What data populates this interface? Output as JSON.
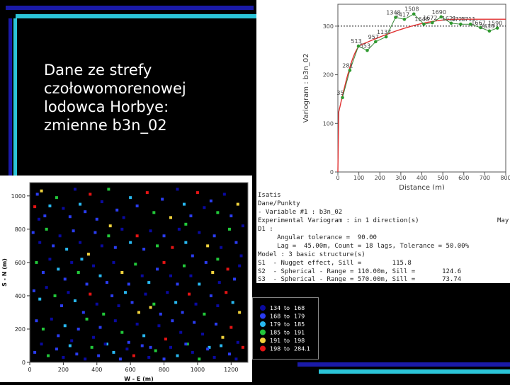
{
  "slide": {
    "title_lines": [
      "Dane ze strefy",
      "czołowomorenowej",
      "lodowca Horbye:",
      "zmienne b3n_02"
    ],
    "colors": {
      "background": "#000000",
      "accent_blue": "#1a1aa8",
      "accent_cyan": "#2bc4d8"
    }
  },
  "info_panel": {
    "lines": [
      "Isatis",
      "Dane/Punkty",
      "- Variable #1 : b3n_02",
      "Experimental Variogram : in 1 direction(s)",
      "D1 :",
      "     Angular tolerance =  90.00",
      "     Lag =  45.00m, Count = 18 lags, Tolerance = 50.00%",
      "Model : 3 basic structure(s)",
      "S1  - Nugget effect, Sill =        115.8",
      "S2  - Spherical - Range = 110.00m, Sill =       124.6",
      "S3  - Spherical - Range = 570.00m, Sill =       73.74"
    ],
    "truncated_right": "May"
  },
  "chart_data": [
    {
      "type": "line",
      "xlabel": "Distance (m)",
      "ylabel": "Variogram : b3n_02",
      "xlim": [
        0,
        800
      ],
      "ylim": [
        0,
        345
      ],
      "xticks": [
        0,
        100,
        200,
        300,
        400,
        500,
        600,
        700,
        800
      ],
      "yticks": [
        0,
        100,
        200,
        300
      ],
      "sill_line": 300,
      "experimental": [
        {
          "x": 22,
          "y": 153,
          "label": "35"
        },
        {
          "x": 57,
          "y": 209,
          "label": "281"
        },
        {
          "x": 98,
          "y": 259,
          "label": "513"
        },
        {
          "x": 140,
          "y": 250,
          "label": "553"
        },
        {
          "x": 180,
          "y": 268,
          "label": "957"
        },
        {
          "x": 230,
          "y": 278,
          "label": "1137"
        },
        {
          "x": 275,
          "y": 318,
          "label": "1348"
        },
        {
          "x": 317,
          "y": 314,
          "label": "1417"
        },
        {
          "x": 362,
          "y": 325,
          "label": "1508"
        },
        {
          "x": 410,
          "y": 304,
          "label": "1646"
        },
        {
          "x": 450,
          "y": 307,
          "label": "1672"
        },
        {
          "x": 492,
          "y": 319,
          "label": "1690"
        },
        {
          "x": 540,
          "y": 306,
          "label": "1621"
        },
        {
          "x": 585,
          "y": 304,
          "label": "1725"
        },
        {
          "x": 632,
          "y": 304,
          "label": "1711"
        },
        {
          "x": 680,
          "y": 297,
          "label": "1667"
        },
        {
          "x": 722,
          "y": 290,
          "label": "1633"
        },
        {
          "x": 760,
          "y": 296,
          "label": "1590"
        }
      ],
      "model": {
        "nugget": 115.8,
        "structures": [
          {
            "type": "spherical",
            "range": 110,
            "sill": 124.6
          },
          {
            "type": "spherical",
            "range": 570,
            "sill": 73.74
          }
        ]
      }
    },
    {
      "type": "scatter",
      "xlabel": "W - E (m)",
      "ylabel": "S - N (m)",
      "xlim": [
        0,
        1300
      ],
      "ylim": [
        0,
        1080
      ],
      "xticks": [
        0,
        200,
        400,
        600,
        800,
        1000,
        1200
      ],
      "yticks": [
        0,
        200,
        400,
        600,
        800,
        1000
      ],
      "legend": [
        {
          "label_from": "134",
          "to": "to",
          "label_to": "168",
          "color": "#0a0aa0"
        },
        {
          "label_from": "168",
          "to": "to",
          "label_to": "179",
          "color": "#2a3cf0"
        },
        {
          "label_from": "179",
          "to": "to",
          "label_to": "185",
          "color": "#28b8f0"
        },
        {
          "label_from": "185",
          "to": "to",
          "label_to": "191",
          "color": "#22c83a"
        },
        {
          "label_from": "191",
          "to": "to",
          "label_to": "198",
          "color": "#f0d23c"
        },
        {
          "label_from": "198",
          "to": "to",
          "label_to": "284.1",
          "color": "#e41414"
        }
      ],
      "points": [
        [
          30,
          935,
          5
        ],
        [
          45,
          1010,
          1
        ],
        [
          55,
          860,
          0
        ],
        [
          70,
          1030,
          4
        ],
        [
          90,
          880,
          1
        ],
        [
          120,
          940,
          2
        ],
        [
          160,
          990,
          3
        ],
        [
          200,
          925,
          0
        ],
        [
          240,
          875,
          1
        ],
        [
          270,
          1040,
          0
        ],
        [
          300,
          950,
          2
        ],
        [
          330,
          905,
          1
        ],
        [
          360,
          1010,
          5
        ],
        [
          400,
          860,
          1
        ],
        [
          430,
          965,
          0
        ],
        [
          470,
          1040,
          3
        ],
        [
          520,
          915,
          1
        ],
        [
          560,
          870,
          0
        ],
        [
          600,
          990,
          2
        ],
        [
          640,
          940,
          1
        ],
        [
          700,
          1020,
          5
        ],
        [
          740,
          900,
          3
        ],
        [
          790,
          980,
          1
        ],
        [
          840,
          870,
          4
        ],
        [
          880,
          1040,
          0
        ],
        [
          920,
          950,
          2
        ],
        [
          960,
          880,
          1
        ],
        [
          1000,
          1020,
          5
        ],
        [
          1040,
          930,
          0
        ],
        [
          1080,
          970,
          1
        ],
        [
          1120,
          900,
          3
        ],
        [
          1160,
          1010,
          0
        ],
        [
          1200,
          880,
          1
        ],
        [
          1240,
          950,
          4
        ],
        [
          1270,
          820,
          0
        ],
        [
          20,
          780,
          1
        ],
        [
          60,
          720,
          0
        ],
        [
          100,
          800,
          3
        ],
        [
          140,
          700,
          1
        ],
        [
          180,
          760,
          0
        ],
        [
          220,
          680,
          2
        ],
        [
          260,
          790,
          1
        ],
        [
          300,
          720,
          0
        ],
        [
          350,
          650,
          4
        ],
        [
          390,
          780,
          1
        ],
        [
          430,
          700,
          0
        ],
        [
          470,
          760,
          3
        ],
        [
          510,
          690,
          1
        ],
        [
          550,
          800,
          0
        ],
        [
          600,
          720,
          2
        ],
        [
          640,
          760,
          5
        ],
        [
          680,
          680,
          1
        ],
        [
          720,
          790,
          0
        ],
        [
          760,
          700,
          3
        ],
        [
          800,
          760,
          1
        ],
        [
          850,
          690,
          5
        ],
        [
          890,
          800,
          0
        ],
        [
          930,
          720,
          2
        ],
        [
          970,
          640,
          1
        ],
        [
          1010,
          780,
          0
        ],
        [
          1060,
          700,
          4
        ],
        [
          1100,
          760,
          1
        ],
        [
          1140,
          690,
          0
        ],
        [
          1190,
          800,
          3
        ],
        [
          1230,
          720,
          1
        ],
        [
          1260,
          640,
          0
        ],
        [
          40,
          600,
          3
        ],
        [
          80,
          540,
          1
        ],
        [
          120,
          620,
          0
        ],
        [
          170,
          560,
          2
        ],
        [
          210,
          500,
          1
        ],
        [
          250,
          600,
          0
        ],
        [
          290,
          540,
          3
        ],
        [
          340,
          470,
          1
        ],
        [
          380,
          580,
          0
        ],
        [
          420,
          520,
          2
        ],
        [
          460,
          480,
          1
        ],
        [
          500,
          600,
          0
        ],
        [
          550,
          540,
          4
        ],
        [
          590,
          470,
          1
        ],
        [
          630,
          590,
          3
        ],
        [
          670,
          520,
          0
        ],
        [
          710,
          480,
          2
        ],
        [
          760,
          560,
          1
        ],
        [
          800,
          600,
          5
        ],
        [
          840,
          520,
          0
        ],
        [
          880,
          470,
          1
        ],
        [
          920,
          580,
          3
        ],
        [
          960,
          520,
          0
        ],
        [
          1010,
          470,
          2
        ],
        [
          1050,
          600,
          1
        ],
        [
          1090,
          540,
          4
        ],
        [
          1130,
          480,
          0
        ],
        [
          1180,
          560,
          5
        ],
        [
          1220,
          500,
          1
        ],
        [
          1250,
          580,
          0
        ],
        [
          25,
          430,
          1
        ],
        [
          60,
          380,
          2
        ],
        [
          100,
          450,
          0
        ],
        [
          150,
          400,
          3
        ],
        [
          190,
          340,
          1
        ],
        [
          230,
          420,
          0
        ],
        [
          270,
          370,
          2
        ],
        [
          320,
          300,
          1
        ],
        [
          360,
          410,
          5
        ],
        [
          400,
          350,
          0
        ],
        [
          440,
          290,
          3
        ],
        [
          490,
          400,
          1
        ],
        [
          530,
          340,
          0
        ],
        [
          570,
          420,
          2
        ],
        [
          610,
          360,
          1
        ],
        [
          650,
          300,
          4
        ],
        [
          690,
          410,
          0
        ],
        [
          740,
          350,
          3
        ],
        [
          780,
          290,
          1
        ],
        [
          820,
          420,
          0
        ],
        [
          870,
          360,
          2
        ],
        [
          910,
          300,
          1
        ],
        [
          950,
          410,
          5
        ],
        [
          990,
          350,
          0
        ],
        [
          1040,
          290,
          3
        ],
        [
          1080,
          400,
          1
        ],
        [
          1120,
          340,
          0
        ],
        [
          1170,
          420,
          5
        ],
        [
          1210,
          360,
          2
        ],
        [
          1250,
          300,
          4
        ],
        [
          40,
          250,
          1
        ],
        [
          80,
          200,
          3
        ],
        [
          130,
          260,
          0
        ],
        [
          170,
          160,
          1
        ],
        [
          210,
          220,
          2
        ],
        [
          250,
          130,
          0
        ],
        [
          290,
          200,
          1
        ],
        [
          340,
          260,
          3
        ],
        [
          380,
          150,
          0
        ],
        [
          420,
          210,
          1
        ],
        [
          460,
          110,
          2
        ],
        [
          510,
          250,
          0
        ],
        [
          550,
          180,
          3
        ],
        [
          590,
          120,
          1
        ],
        [
          640,
          230,
          0
        ],
        [
          680,
          160,
          2
        ],
        [
          720,
          90,
          1
        ],
        [
          770,
          220,
          0
        ],
        [
          810,
          140,
          5
        ],
        [
          850,
          250,
          1
        ],
        [
          900,
          180,
          0
        ],
        [
          940,
          110,
          3
        ],
        [
          980,
          240,
          1
        ],
        [
          1030,
          170,
          0
        ],
        [
          1070,
          90,
          2
        ],
        [
          1110,
          230,
          1
        ],
        [
          1150,
          150,
          4
        ],
        [
          1200,
          210,
          5
        ],
        [
          1240,
          120,
          0
        ],
        [
          30,
          60,
          1
        ],
        [
          70,
          110,
          0
        ],
        [
          110,
          40,
          3
        ],
        [
          160,
          80,
          1
        ],
        [
          200,
          30,
          0
        ],
        [
          240,
          100,
          2
        ],
        [
          280,
          50,
          1
        ],
        [
          330,
          20,
          0
        ],
        [
          370,
          90,
          3
        ],
        [
          410,
          40,
          1
        ],
        [
          450,
          110,
          0
        ],
        [
          500,
          60,
          2
        ],
        [
          540,
          20,
          1
        ],
        [
          580,
          80,
          0
        ],
        [
          620,
          40,
          5
        ],
        [
          670,
          100,
          1
        ],
        [
          710,
          30,
          0
        ],
        [
          750,
          70,
          3
        ],
        [
          800,
          20,
          1
        ],
        [
          840,
          90,
          0
        ],
        [
          880,
          40,
          2
        ],
        [
          930,
          110,
          1
        ],
        [
          970,
          60,
          0
        ],
        [
          1010,
          20,
          3
        ],
        [
          1060,
          80,
          1
        ],
        [
          1100,
          30,
          0
        ],
        [
          1140,
          100,
          2
        ],
        [
          1190,
          50,
          1
        ],
        [
          1230,
          20,
          0
        ],
        [
          1270,
          90,
          5
        ],
        [
          310,
          620,
          2
        ],
        [
          720,
          330,
          4
        ],
        [
          1120,
          620,
          3
        ],
        [
          480,
          820,
          4
        ],
        [
          930,
          830,
          3
        ]
      ]
    }
  ]
}
